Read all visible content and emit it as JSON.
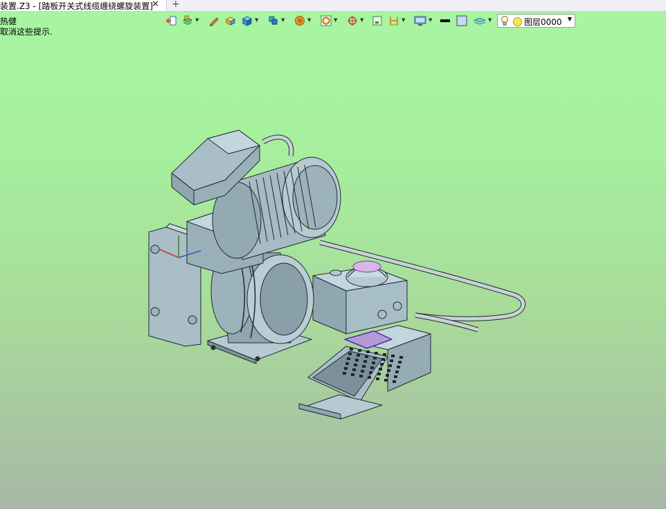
{
  "tab": {
    "title": "装置.Z3 - [踏板开关式线缆缠绕螺旋装置]",
    "close": "✕",
    "add": "+"
  },
  "hints": {
    "line1": "热健",
    "line2": "取消这些提示."
  },
  "toolbar": {
    "icons": [
      "exit-sketch-icon",
      "layer-stack-icon",
      "pencil-icon",
      "box-yellow-icon",
      "solid-cube-icon",
      "view-cube-icon",
      "orange-wheel-icon",
      "render-mode-icon",
      "target-icon",
      "frame-icon",
      "dimension-icon",
      "display-icon",
      "line-color-icon",
      "fill-color-icon",
      "surface-icon"
    ],
    "line_color": "#000000",
    "fill_color": "#c5d9f1"
  },
  "layer": {
    "name": "图层0000",
    "dot_color": "#f4e84a"
  },
  "colors": {
    "part": "#a9bec6",
    "part_dark": "#7d939b",
    "edge": "#1d2a2e",
    "cable": "#c8d3d6",
    "highlight": "#b69ad8"
  }
}
